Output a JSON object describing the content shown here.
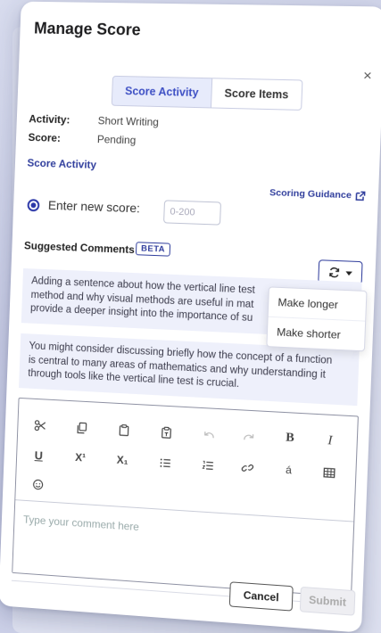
{
  "modal": {
    "title": "Manage Score",
    "close_symbol": "×"
  },
  "tabs": [
    {
      "label": "Score Activity",
      "active": true
    },
    {
      "label": "Score Items",
      "active": false
    }
  ],
  "details": {
    "activity_label": "Activity:",
    "activity_value": "Short Writing",
    "score_label": "Score:",
    "score_value": "Pending"
  },
  "section_link": "Score Activity",
  "scoring_guidance": {
    "label": "Scoring Guidance",
    "icon": "external-link-icon"
  },
  "score_entry": {
    "label": "Enter new score:",
    "placeholder": "0-200",
    "value": ""
  },
  "suggested": {
    "title": "Suggested Comments",
    "badge": "BETA",
    "comments": [
      {
        "lines": [
          "Adding a sentence about how the vertical line test",
          "method and why visual methods are useful in mat",
          "provide a deeper insight into the importance of su"
        ]
      },
      {
        "lines": [
          "You might consider discussing briefly how the concept of a function",
          "is central to many areas of mathematics and why understanding it",
          "through tools like the vertical line test is crucial."
        ]
      }
    ],
    "menu": [
      "Make longer",
      "Make shorter"
    ]
  },
  "toolbar": {
    "bold": "B",
    "italic": "I",
    "underline": "U",
    "superscript": "X¹",
    "subscript": "X₁",
    "special_char": "á"
  },
  "editor": {
    "placeholder": "Type your comment here"
  },
  "buttons": {
    "cancel": "Cancel",
    "submit": "Submit"
  },
  "colors": {
    "accent": "#2f3d9c",
    "tab_active_bg": "#e7ebfb",
    "comment_bg": "#eef0fb"
  }
}
